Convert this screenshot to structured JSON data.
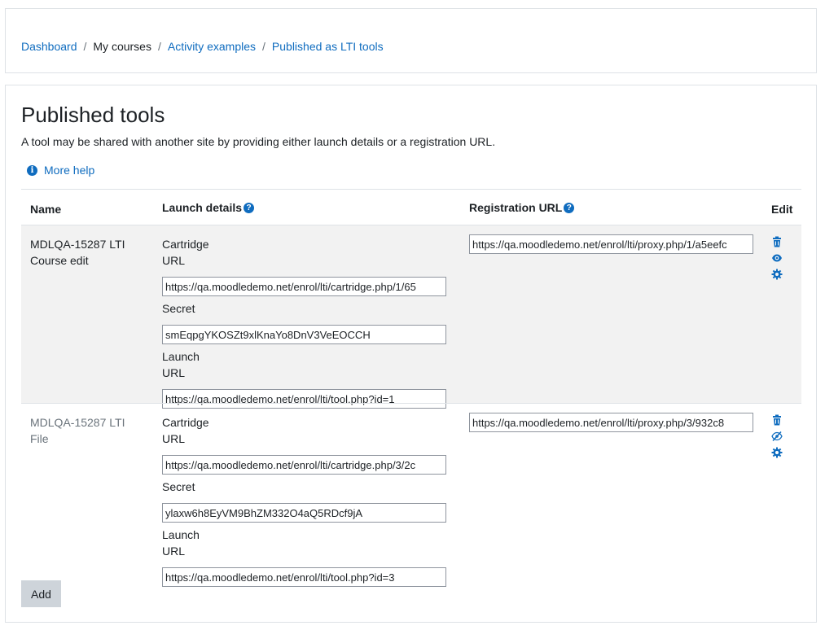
{
  "breadcrumb": {
    "items": [
      {
        "label": "Dashboard"
      },
      {
        "label": "My courses"
      },
      {
        "label": "Activity examples"
      },
      {
        "label": "Published as LTI tools"
      }
    ],
    "separator": "/"
  },
  "page": {
    "title": "Published tools",
    "intro": "A tool may be shared with another site by providing either launch details or a registration URL.",
    "help_link": "More help"
  },
  "table": {
    "headers": {
      "name": "Name",
      "launch": "Launch details",
      "registration": "Registration URL",
      "edit": "Edit"
    },
    "labels": {
      "cartridge": "Cartridge",
      "url": "URL",
      "secret": "Secret",
      "launch": "Launch"
    },
    "rows": [
      {
        "name": "MDLQA-15287 LTI Course edit",
        "cartridge_url": "https://qa.moodledemo.net/enrol/lti/cartridge.php/1/65",
        "secret": "smEqpgYKOSZt9xlKnaYo8DnV3VeEOCCH",
        "launch_url": "https://qa.moodledemo.net/enrol/lti/tool.php?id=1",
        "registration_url": "https://qa.moodledemo.net/enrol/lti/proxy.php/1/a5eefc",
        "icons": [
          "trash-icon",
          "eye-icon",
          "gear-icon"
        ]
      },
      {
        "name": "MDLQA-15287 LTI File",
        "cartridge_url": "https://qa.moodledemo.net/enrol/lti/cartridge.php/3/2c",
        "secret": "ylaxw6h8EyVM9BhZM332O4aQ5RDcf9jA",
        "launch_url": "https://qa.moodledemo.net/enrol/lti/tool.php?id=3",
        "registration_url": "https://qa.moodledemo.net/enrol/lti/proxy.php/3/932c8",
        "icons": [
          "trash-icon",
          "eye-slash-icon",
          "gear-icon"
        ]
      }
    ]
  },
  "add_button": "Add",
  "colors": {
    "link": "#0f6cbf",
    "border": "#dee2e6",
    "stripe": "#f2f2f2",
    "button_bg": "#ced4da",
    "muted_text": "#6a737b"
  }
}
